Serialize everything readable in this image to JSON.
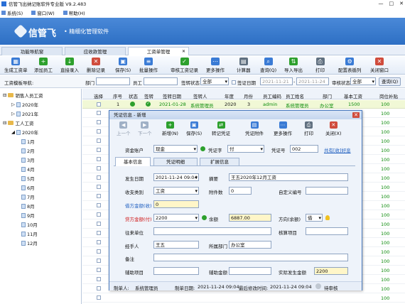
{
  "window": {
    "title": "信管飞出纳记账软件专业版 V9.2.483",
    "minimize": "—",
    "maximize": "□",
    "close": "✕"
  },
  "menu": [
    {
      "label": "系统(S)"
    },
    {
      "label": "窗口(W)"
    },
    {
      "label": "帮助(H)"
    }
  ],
  "banner": {
    "brand": "信管飞",
    "slogan": "• 精细化管理软件"
  },
  "main_tabs": [
    {
      "label": "功能导航窗"
    },
    {
      "label": "应收款管理"
    },
    {
      "label": "工资单管理",
      "close": "✕"
    }
  ],
  "toolbar": [
    {
      "label": "生成工资单",
      "icon": "generate-icon",
      "color": "#3a7bd5"
    },
    {
      "label": "添加员工",
      "icon": "add-icon",
      "color": "#2da02d"
    },
    {
      "label": "直接录入",
      "icon": "input-icon",
      "color": "#2da02d"
    },
    {
      "label": "删除记录",
      "icon": "delete-icon",
      "color": "#d04c3c"
    },
    {
      "label": "保存(S)",
      "icon": "save-icon",
      "color": "#3a7bd5"
    },
    {
      "label": "批量操作",
      "icon": "batch-icon",
      "color": "#3a7bd5"
    },
    {
      "label": "审核工资记录",
      "icon": "audit-icon",
      "color": "#2da02d"
    },
    {
      "label": "更多操作",
      "icon": "more-icon",
      "color": "#3a7bd5"
    },
    {
      "label": "计算器",
      "icon": "calculator-icon",
      "color": "#607080"
    },
    {
      "label": "查询(Q)",
      "icon": "query-icon",
      "color": "#3a7bd5"
    },
    {
      "label": "导入导出",
      "icon": "import-export-icon",
      "color": "#2da02d"
    },
    {
      "label": "打印",
      "icon": "print-icon",
      "color": "#607080"
    },
    {
      "label": "配置表循列",
      "icon": "config-icon",
      "color": "#3a7bd5"
    },
    {
      "label": "关闭窗口",
      "icon": "close-window-icon",
      "color": "#d04c3c"
    }
  ],
  "filter": {
    "nav_label": "工资模板导航:",
    "dept_label": "部门",
    "staff_label": "员工",
    "sign_status_label": "签转状态",
    "sign_status_value": "全部",
    "sign_date_label": "签证日期",
    "date_from": "2021-11-21",
    "date_to": "2021-11-24",
    "audit_status_label": "审核状态",
    "audit_status_value": "全部",
    "query_button": "查询(Q)"
  },
  "tree": {
    "nodes": [
      {
        "label": "销售人员工资",
        "type": "folder"
      },
      {
        "label": "2020年",
        "type": "file"
      },
      {
        "label": "2021年",
        "type": "file"
      },
      {
        "label": "工人工资",
        "type": "folder"
      },
      {
        "label": "2020年",
        "type": "file"
      },
      {
        "label": "1月",
        "type": "file"
      },
      {
        "label": "2月",
        "type": "file"
      },
      {
        "label": "3月",
        "type": "file"
      },
      {
        "label": "4月",
        "type": "file"
      },
      {
        "label": "5月",
        "type": "file"
      },
      {
        "label": "6月",
        "type": "file"
      },
      {
        "label": "7月",
        "type": "file"
      },
      {
        "label": "8月",
        "type": "file"
      },
      {
        "label": "9月",
        "type": "file"
      },
      {
        "label": "10月",
        "type": "file"
      },
      {
        "label": "11月",
        "type": "file"
      },
      {
        "label": "12月",
        "type": "file"
      }
    ]
  },
  "grid": {
    "headers": [
      "选择",
      "序号",
      "状态",
      "签转",
      "签转日期",
      "签转人",
      "年度",
      "月份",
      "员工编码",
      "员工姓名",
      "部门",
      "基本工资",
      "岗位补贴"
    ],
    "row": {
      "seq": "1",
      "date": "2021-01-28",
      "signer": "系统管理员",
      "year": "2020",
      "month": "3",
      "code": "admin",
      "name": "系统管理员",
      "dept": "办公室",
      "base": "1500",
      "bonus": "100"
    },
    "extra_bonus": [
      "100",
      "100",
      "100",
      "100",
      "100",
      "100",
      "100",
      "100",
      "100",
      "100",
      "100",
      "100",
      "100",
      "100",
      "100",
      "100",
      "100",
      "100",
      "100",
      "100",
      "100"
    ]
  },
  "dialog": {
    "title": "凭证信息 - 新增",
    "close": "✕",
    "toolbar": [
      {
        "label": "上一个",
        "icon": "prev-icon",
        "color": "#9fb0c6"
      },
      {
        "label": "下一个",
        "icon": "next-icon",
        "color": "#9fb0c6"
      },
      {
        "label": "新增(N)",
        "icon": "new-icon",
        "color": "#2da02d"
      },
      {
        "label": "保存(S)",
        "icon": "save-icon",
        "color": "#3a7bd5"
      },
      {
        "label": "转记凭证",
        "icon": "transfer-icon",
        "color": "#2da02d"
      },
      {
        "label": "凭证附件",
        "icon": "attachment-icon",
        "color": "#3a7bd5"
      },
      {
        "label": "更多操作",
        "icon": "more-icon",
        "color": "#3a7bd5"
      },
      {
        "label": "打印",
        "icon": "print-icon",
        "color": "#607080"
      },
      {
        "label": "关闭(X)",
        "icon": "close-icon",
        "color": "#d04c3c"
      }
    ],
    "account_label": "资金账户",
    "account_value": "现金",
    "voucher_word_label": "凭证字",
    "voucher_word_value": "付",
    "voucher_no_label": "凭证号",
    "voucher_no_value": "002",
    "share_link": "共有[收]好息",
    "tabs": [
      {
        "label": "基本信息"
      },
      {
        "label": "凭证明细"
      },
      {
        "label": "扩展信息"
      }
    ],
    "occur_date_label": "发生日期",
    "occur_date_value": "2021-11-24 09:04",
    "summary_label": "摘要",
    "summary_value": "王五2020年12月工资",
    "pay_type_label": "收支类别",
    "pay_type_value": "工资",
    "attach_label": "附件数",
    "attach_value": "0",
    "custom_no_label": "自定义编号",
    "custom_no_value": "",
    "debit_label": "借方金额(收)",
    "debit_value": "0",
    "credit_label": "贷方金额(付)",
    "credit_value": "2200",
    "balance_label": "余额",
    "balance_value": "6887.00",
    "direction_label": "方向(余额)",
    "direction_value": "借",
    "unit_label": "往来单位",
    "unit_value": "",
    "check_item_label": "核算项目",
    "check_item_value": "",
    "handler_label": "经手人",
    "handler_value": "王五",
    "dept_label": "所属部门",
    "dept_value": "办公室",
    "note_label": "备注",
    "note_value": "",
    "aux_item_label": "辅助项目",
    "aux_item_value": "",
    "aux_amount_label": "辅助金额",
    "aux_amount_value": "",
    "actual_label": "实际发生金额",
    "actual_value": "2200",
    "status": {
      "creator_label": "制单人:",
      "creator": "系统管理员",
      "create_date_label": "制单日期:",
      "create_date": "2021-11-24 09:04",
      "modify_label": "最后修改时间:",
      "modify": "2021-11-24 09:04",
      "audit_status": "待审核"
    }
  },
  "colors": {
    "banner": "#2d6fc4",
    "accent": "#4a7bc0",
    "selected_row": "#f1f8d6"
  }
}
